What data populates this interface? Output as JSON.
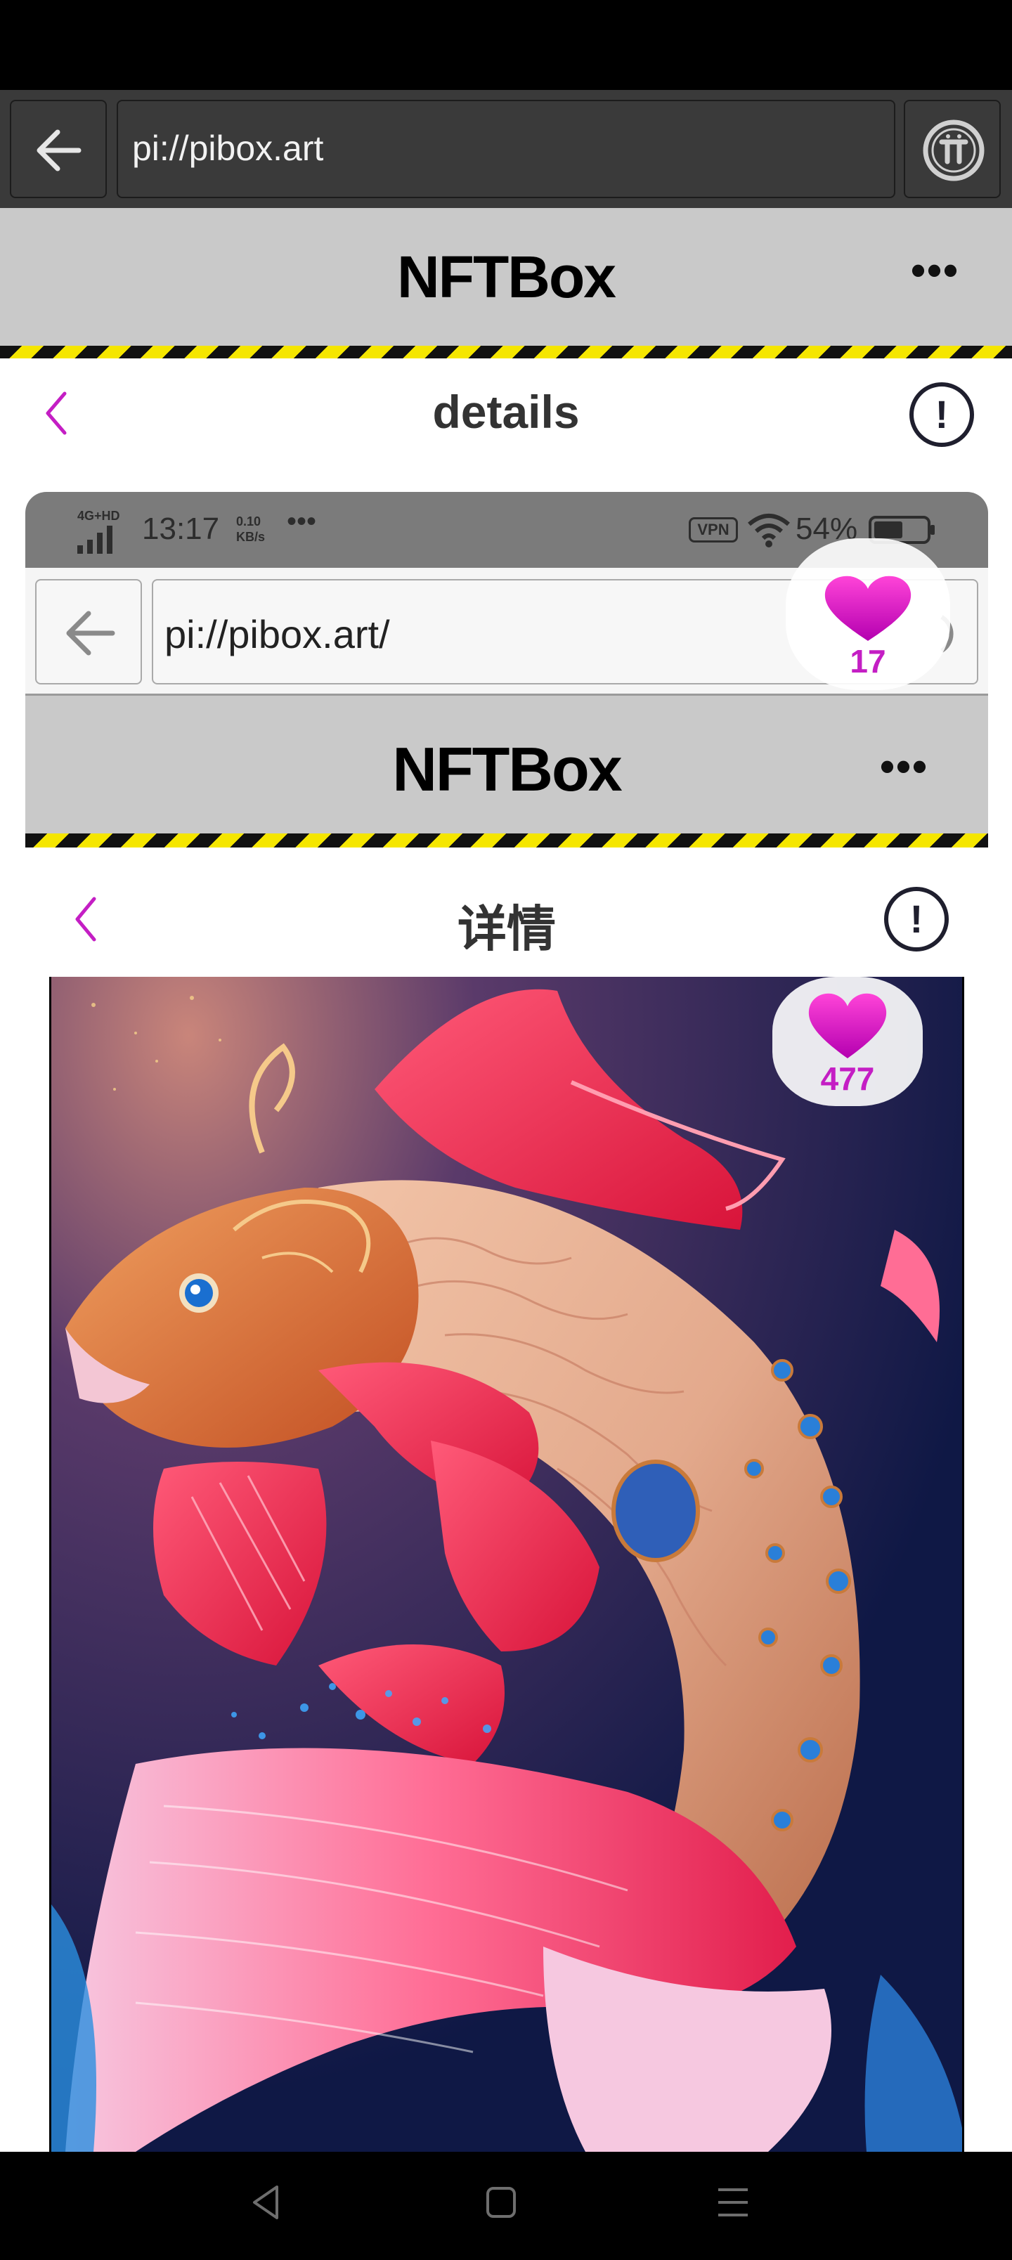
{
  "browser": {
    "url": "pi://pibox.art",
    "back_icon": "arrow-left-icon",
    "pi_icon": "pi-logo-icon"
  },
  "app": {
    "title": "NFTBox",
    "menu_label": "•••"
  },
  "page": {
    "title": "details",
    "back_icon": "chevron-left-icon",
    "info_icon": "exclamation-circle-icon",
    "info_glyph": "!",
    "favorites": {
      "count": "17"
    }
  },
  "inner_screenshot": {
    "status_bar": {
      "network": "4G+HD",
      "time": "13:17",
      "speed_value": "0.10",
      "speed_unit": "KB/s",
      "more": "•••",
      "vpn": "VPN",
      "battery": "54%"
    },
    "browser": {
      "url": "pi://pibox.art/"
    },
    "app": {
      "title": "NFTBox",
      "menu_label": "•••"
    },
    "page": {
      "title": "详情",
      "info_glyph": "!"
    },
    "nft": {
      "likes": "477"
    }
  },
  "nav": {
    "back_icon": "triangle-back-icon",
    "home_icon": "square-home-icon",
    "menu_icon": "menu-lines-icon"
  },
  "colors": {
    "accent": "#c41ec4",
    "header_gray": "#c9c9c9",
    "browser_dark": "#3a3a3a",
    "hazard_yellow": "#f5e600"
  }
}
